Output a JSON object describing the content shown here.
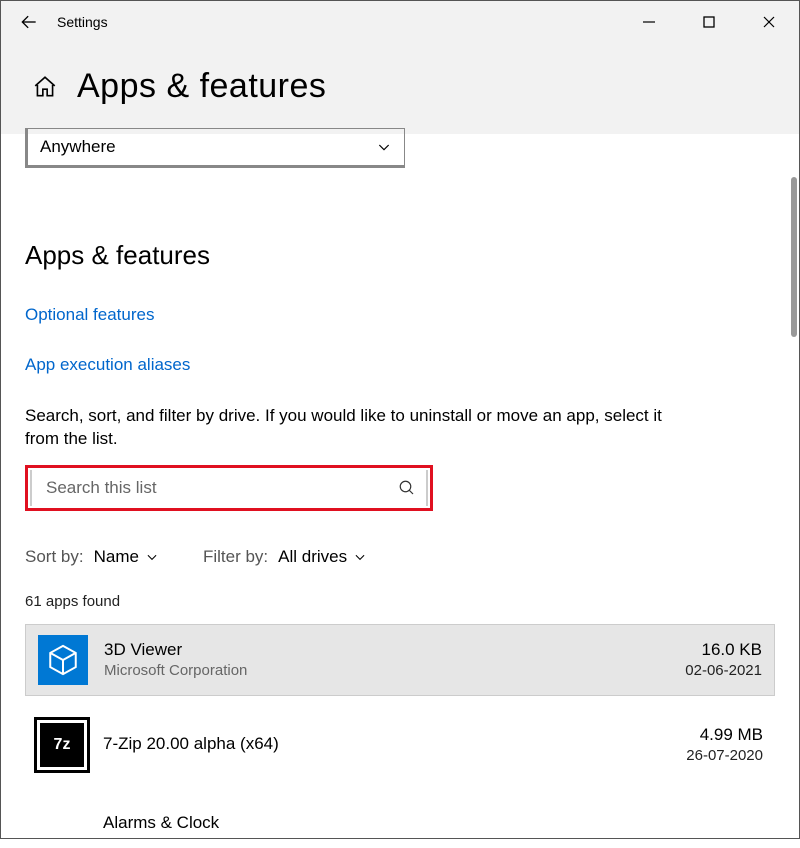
{
  "titlebar": {
    "title": "Settings"
  },
  "header": {
    "page_title": "Apps & features"
  },
  "install_source_dropdown": {
    "value": "Anywhere"
  },
  "section": {
    "title": "Apps & features",
    "link_optional": "Optional features",
    "link_aliases": "App execution aliases",
    "description": "Search, sort, and filter by drive. If you would like to uninstall or move an app, select it from the list."
  },
  "search": {
    "placeholder": "Search this list"
  },
  "sort": {
    "label": "Sort by:",
    "value": "Name"
  },
  "filter": {
    "label": "Filter by:",
    "value": "All drives"
  },
  "count": "61 apps found",
  "apps": [
    {
      "name": "3D Viewer",
      "vendor": "Microsoft Corporation",
      "size": "16.0 KB",
      "date": "02-06-2021"
    },
    {
      "name": "7-Zip 20.00 alpha (x64)",
      "vendor": "",
      "size": "4.99 MB",
      "date": "26-07-2020"
    },
    {
      "name": "Alarms & Clock",
      "vendor": "",
      "size": "",
      "date": ""
    }
  ]
}
